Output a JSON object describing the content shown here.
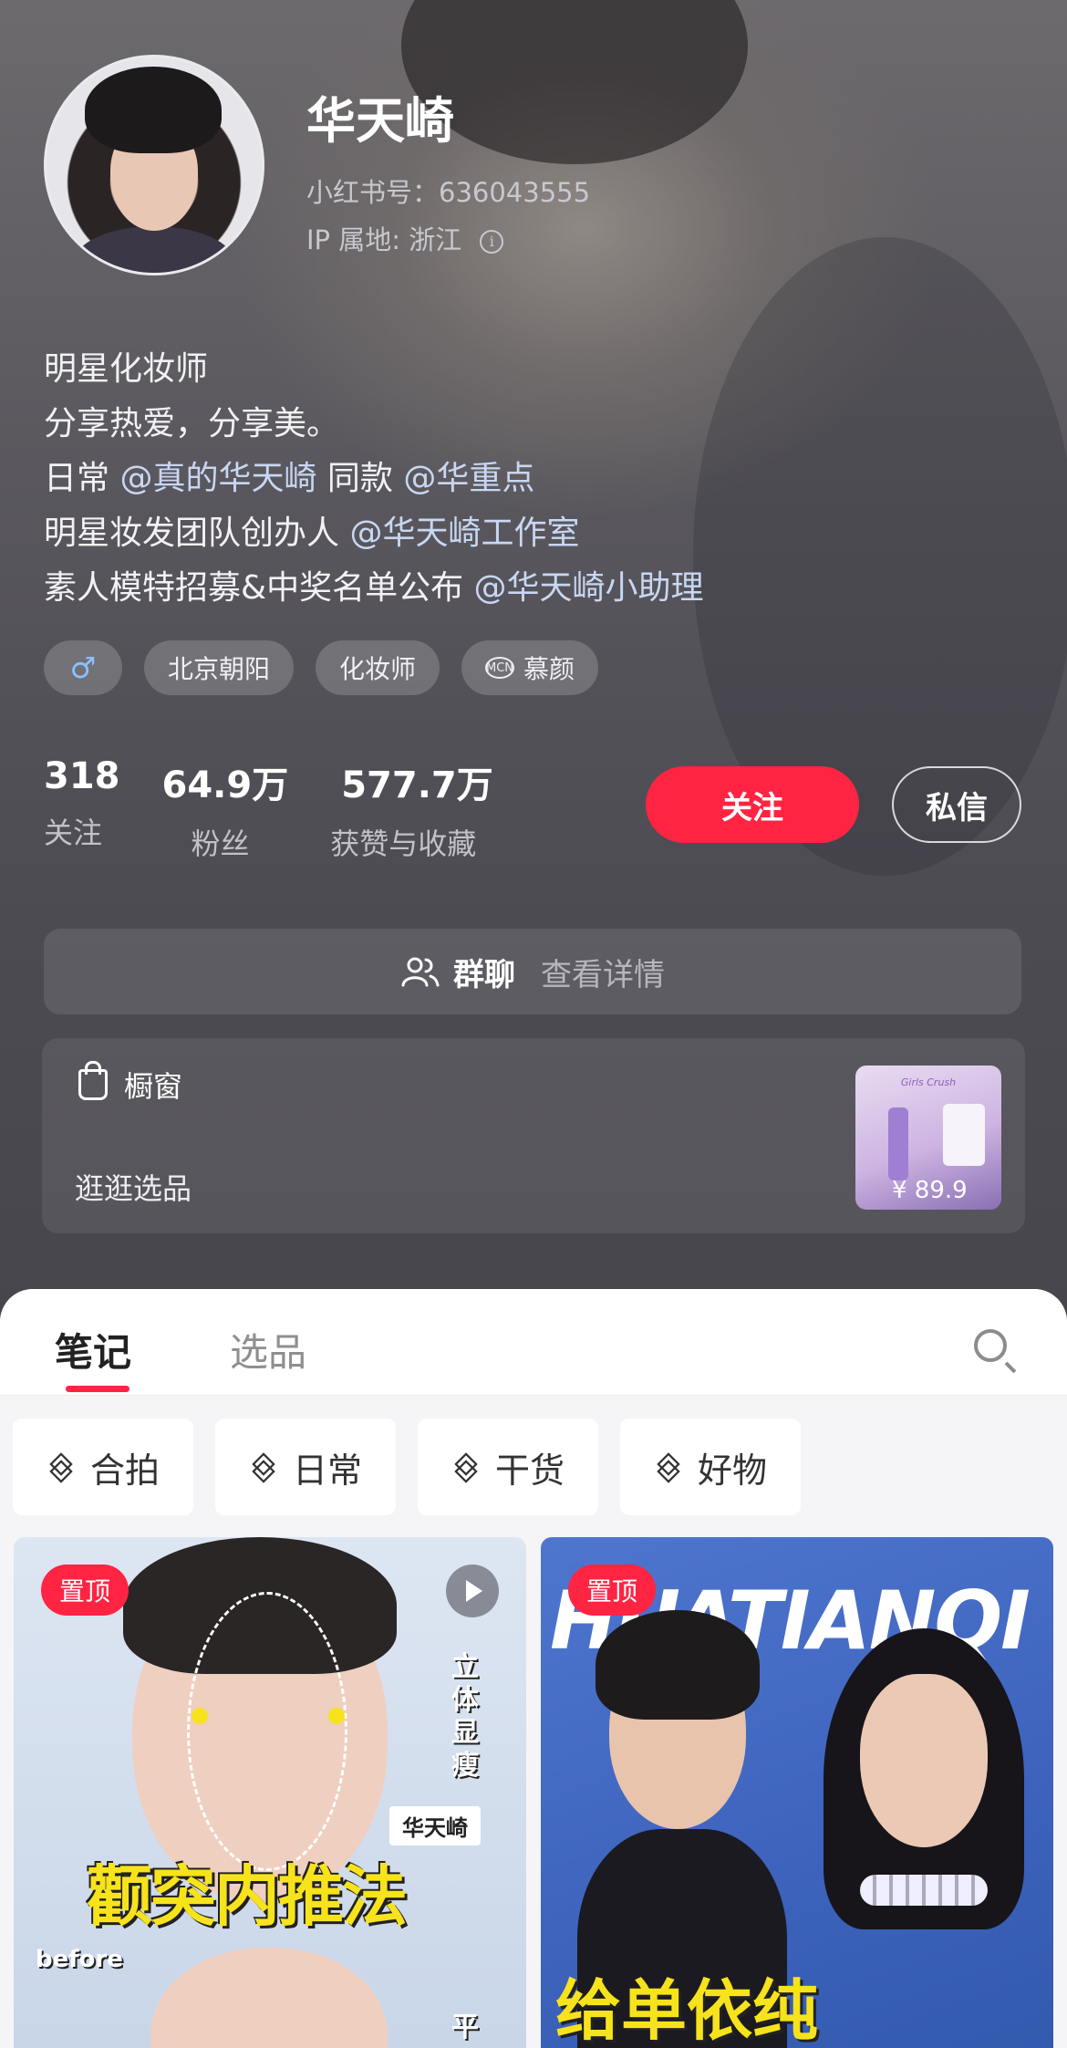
{
  "profile": {
    "name": "华天崎",
    "red_id": "小红书号：636043555",
    "ip_location": "IP 属地: 浙江",
    "bio": [
      {
        "parts": [
          {
            "text": "明星化妆师",
            "mention": false
          }
        ]
      },
      {
        "parts": [
          {
            "text": "分享热爱，分享美。",
            "mention": false
          }
        ]
      },
      {
        "parts": [
          {
            "text": "日常 ",
            "mention": false
          },
          {
            "text": "@真的华天崎",
            "mention": true
          },
          {
            "text": " 同款 ",
            "mention": false
          },
          {
            "text": "@华重点",
            "mention": true
          }
        ]
      },
      {
        "parts": [
          {
            "text": "明星妆发团队创办人 ",
            "mention": false
          },
          {
            "text": "@华天崎工作室",
            "mention": true
          }
        ]
      },
      {
        "parts": [
          {
            "text": "素人模特招募&中奖名单公布 ",
            "mention": false
          },
          {
            "text": "@华天崎小助理",
            "mention": true
          }
        ]
      }
    ],
    "tags": {
      "gender": "♂",
      "location": "北京朝阳",
      "profession": "化妆师",
      "mcn_icon": "MCN",
      "mcn": "慕颜"
    }
  },
  "stats": [
    {
      "value": "318",
      "label": "关注"
    },
    {
      "value": "64.9万",
      "label": "粉丝"
    },
    {
      "value": "577.7万",
      "label": "获赞与收藏"
    }
  ],
  "actions": {
    "follow": "关注",
    "message": "私信"
  },
  "group_chat": {
    "label": "群聊",
    "detail": "查看详情"
  },
  "shop": {
    "title": "橱窗",
    "browse": "逛逛选品",
    "product_brand": "Girls Crush",
    "product_price": "¥ 89.9"
  },
  "tabs": {
    "notes": "笔记",
    "selection": "选品"
  },
  "filters": [
    "合拍",
    "日常",
    "干货",
    "好物"
  ],
  "cards": [
    {
      "pin": "置顶",
      "headline": "颧突内推法",
      "side": "立体显瘦",
      "name_tag": "华天崎",
      "before": "before",
      "bottom_char": "平"
    },
    {
      "pin": "置顶",
      "banner": "HUATIANQI",
      "headline": "给单依纯"
    }
  ],
  "colors": {
    "accent": "#ff2442",
    "mention": "#c8d7f2",
    "headline_yellow": "#f7e31b"
  },
  "icons": {
    "search": "search-icon",
    "layers": "layers-icon",
    "group": "group-icon",
    "bag": "shopping-bag-icon",
    "play": "play-icon",
    "info": "info-icon"
  }
}
